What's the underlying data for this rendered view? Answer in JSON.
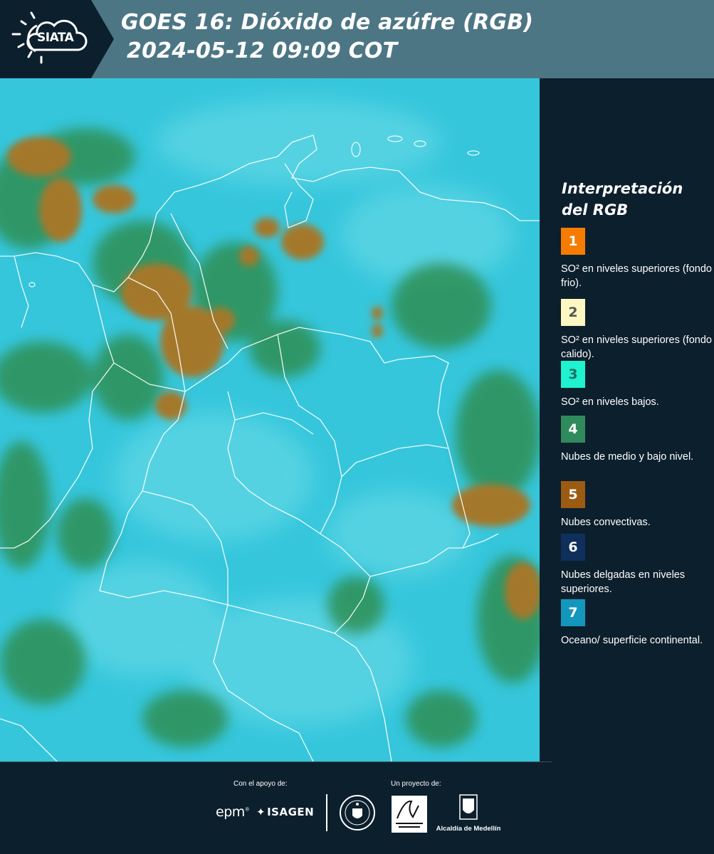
{
  "header": {
    "title_line1": "GOES 16: Dióxido de azúfre (RGB)",
    "title_line2": "2024-05-12 09:09 COT",
    "logo_text": "SIATA",
    "logo_icon": "sun-cloud-icon"
  },
  "colors": {
    "header_band": "#4d7685",
    "logo_panel": "#0c1f2d",
    "background": "#0c1f2d",
    "map_base": "#34c7dc",
    "map_cloud_green": "#2f8a4e",
    "map_convective": "#a87a2a"
  },
  "legend": {
    "title": "Interpretación del RGB",
    "items": [
      {
        "number": "1",
        "label": "SO² en niveles superiores (fondo frio).",
        "color": "#f57c00",
        "text_color": "#ffffff"
      },
      {
        "number": "2",
        "label": "SO² en niveles superiores (fondo calido).",
        "color": "#fff7c2",
        "text_color": "#555555"
      },
      {
        "number": "3",
        "label": "SO² en niveles bajos.",
        "color": "#1ff2cf",
        "text_color": "#1a6f66"
      },
      {
        "number": "4",
        "label": "Nubes de medio y bajo nivel.",
        "color": "#2f8b5c",
        "text_color": "#ffffff"
      },
      {
        "number": "5",
        "label": "Nubes convectivas.",
        "color": "#9b5b12",
        "text_color": "#ffffff"
      },
      {
        "number": "6",
        "label": "Nubes delgadas en niveles superiores.",
        "color": "#0f2f5c",
        "text_color": "#ffffff"
      },
      {
        "number": "7",
        "label": "Oceano/ superficie continental.",
        "color": "#1497bd",
        "text_color": "#ffffff"
      }
    ]
  },
  "footer": {
    "support_label": "Con el apoyo de:",
    "project_label": "Un proyecto de:",
    "sponsor_1": "epm",
    "sponsor_2": "ISAGEN",
    "partner_1": "Área Metropolitana Valle de Aburrá",
    "partner_2": "Alcaldía de Medellín"
  }
}
